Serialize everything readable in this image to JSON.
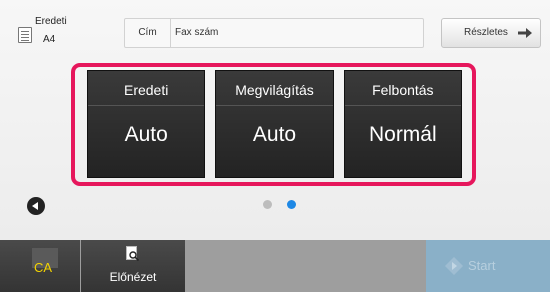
{
  "header": {
    "original_label": "Eredeti",
    "original_size": "A4",
    "subject_label": "Cím",
    "fax_number_field": "Fax szám",
    "details_button": "Részletes"
  },
  "keys": [
    {
      "title": "Eredeti",
      "value": "Auto"
    },
    {
      "title": "Megvilágítás",
      "value": "Auto"
    },
    {
      "title": "Felbontás",
      "value": "Normál"
    }
  ],
  "pager": {
    "current_page": 2,
    "total_pages": 2
  },
  "bottom": {
    "ca_label": "CA",
    "preview_label": "Előnézet",
    "start_label": "Start"
  },
  "colors": {
    "highlight_frame": "#e6175c",
    "active_dot": "#1e88e5",
    "ca_text": "#f4d400",
    "start_disabled": "#8ab0c8"
  }
}
